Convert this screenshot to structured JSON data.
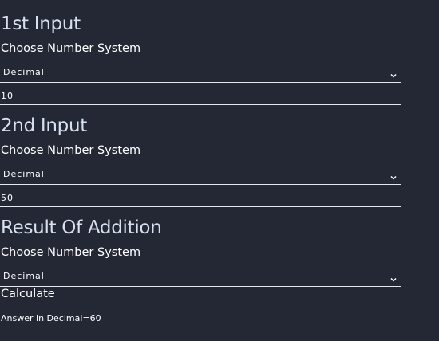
{
  "input1": {
    "title": "1st Input",
    "choose_label": "Choose Number System",
    "system": "Decimal",
    "value": "10"
  },
  "input2": {
    "title": "2nd Input",
    "choose_label": "Choose Number System",
    "system": "Decimal",
    "value": "50"
  },
  "result": {
    "title": "Result Of Addition",
    "choose_label": "Choose Number System",
    "system": "Decimal",
    "calculate_label": "Calculate",
    "answer_text": "Answer in Decimal=60"
  },
  "icons": {
    "dropdown": "chevron-down-icon"
  },
  "colors": {
    "background": "#232834",
    "title": "#d7e0ee",
    "text": "#ffffff",
    "underline": "#e6e8ec"
  }
}
